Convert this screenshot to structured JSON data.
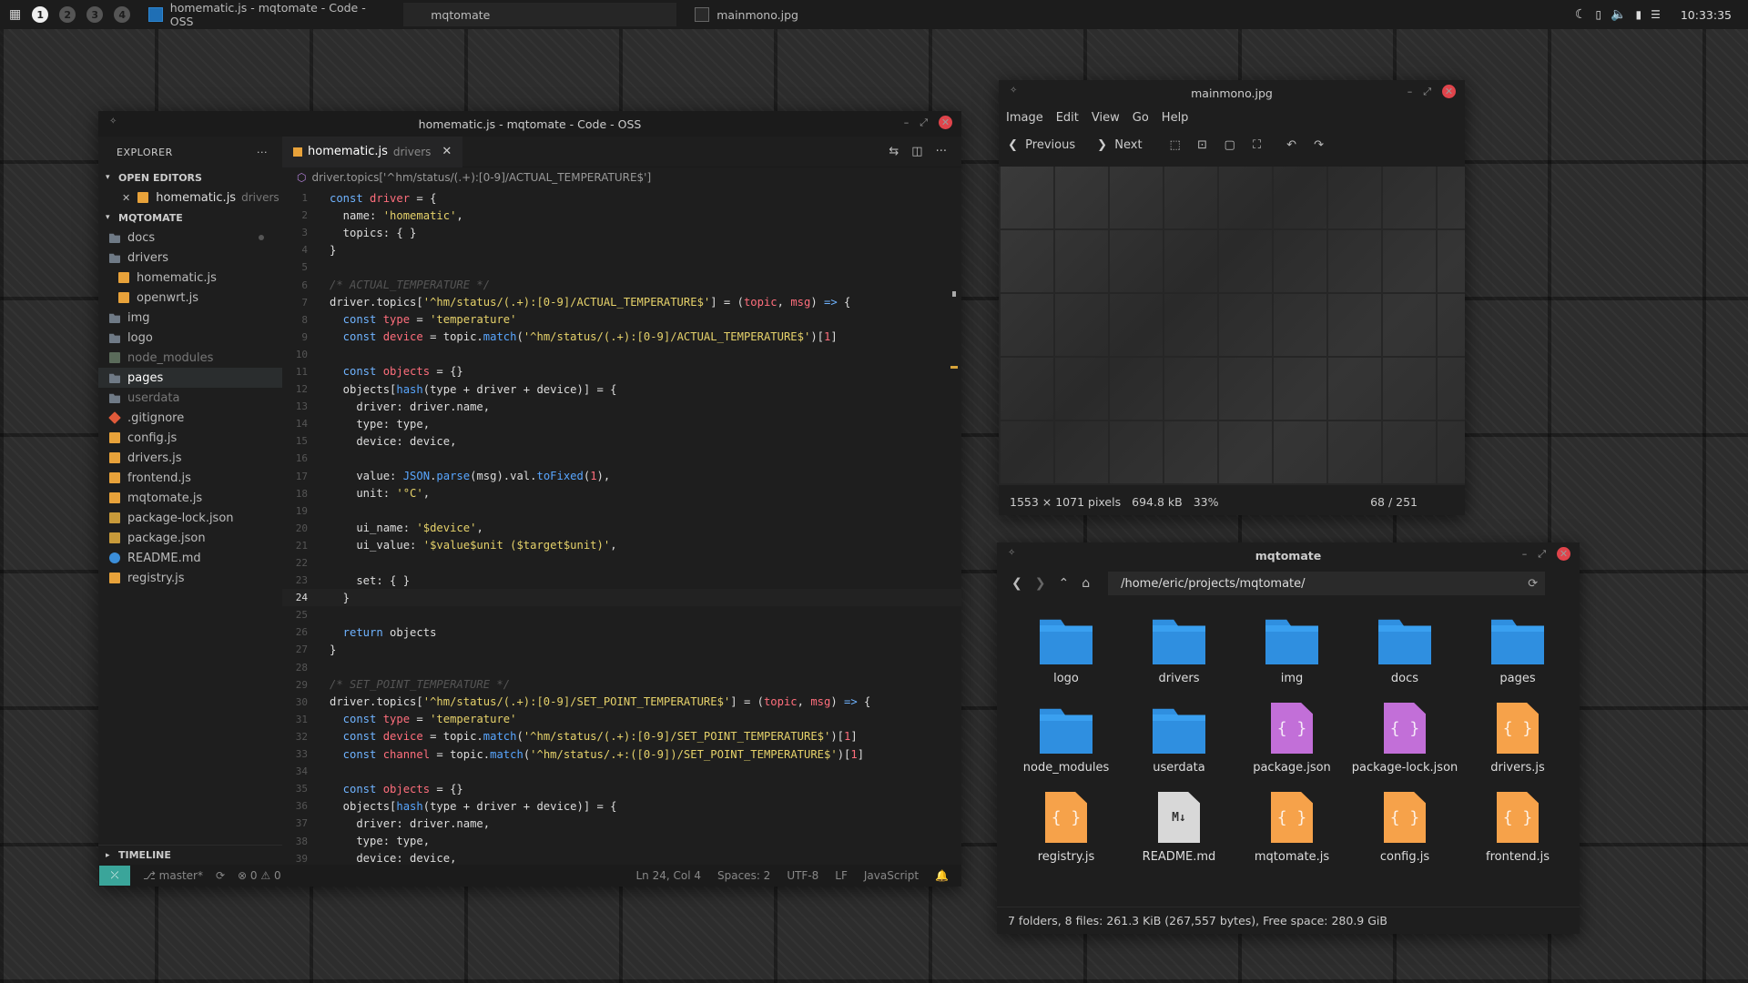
{
  "topbar": {
    "workspaces": [
      "1",
      "2",
      "3",
      "4"
    ],
    "tasks": [
      {
        "title": "homematic.js - mqtomate - Code - OSS"
      },
      {
        "title": "mqtomate"
      },
      {
        "title": "mainmono.jpg"
      }
    ],
    "clock": "10:33:35"
  },
  "vscode": {
    "title": "homematic.js - mqtomate - Code - OSS",
    "explorer": {
      "header": "EXPLORER",
      "dots": "···",
      "open_editors": "OPEN EDITORS",
      "open_file": {
        "name": "homematic.js",
        "dir": "drivers"
      },
      "project": "MQTOMATE",
      "tree": [
        {
          "name": "docs",
          "type": "folder",
          "indent": 0,
          "dot": true
        },
        {
          "name": "drivers",
          "type": "folder",
          "indent": 0
        },
        {
          "name": "homematic.js",
          "type": "js",
          "indent": 1
        },
        {
          "name": "openwrt.js",
          "type": "js",
          "indent": 1
        },
        {
          "name": "img",
          "type": "folder",
          "indent": 0
        },
        {
          "name": "logo",
          "type": "folder",
          "indent": 0
        },
        {
          "name": "node_modules",
          "type": "nm",
          "indent": 0,
          "muted": true
        },
        {
          "name": "pages",
          "type": "folder",
          "indent": 0,
          "selected": true
        },
        {
          "name": "userdata",
          "type": "folder",
          "indent": 0,
          "muted": true
        },
        {
          "name": ".gitignore",
          "type": "git",
          "indent": 0
        },
        {
          "name": "config.js",
          "type": "js",
          "indent": 0
        },
        {
          "name": "drivers.js",
          "type": "js",
          "indent": 0
        },
        {
          "name": "frontend.js",
          "type": "js",
          "indent": 0
        },
        {
          "name": "mqtomate.js",
          "type": "js",
          "indent": 0
        },
        {
          "name": "package-lock.json",
          "type": "json",
          "indent": 0
        },
        {
          "name": "package.json",
          "type": "json",
          "indent": 0
        },
        {
          "name": "README.md",
          "type": "info",
          "indent": 0
        },
        {
          "name": "registry.js",
          "type": "js",
          "indent": 0
        }
      ],
      "timeline": "TIMELINE"
    },
    "tab": {
      "name": "homematic.js",
      "dir": "drivers",
      "close": "✕"
    },
    "breadcrumb": "driver.topics['^hm/status/(.+):[0-9]/ACTUAL_TEMPERATURE$']",
    "current_line": 24,
    "code": [
      [
        [
          "k",
          "const "
        ],
        [
          "v",
          "driver"
        ],
        [
          "p",
          " = {"
        ]
      ],
      [
        [
          "p",
          "  name: "
        ],
        [
          "s",
          "'homematic'"
        ],
        [
          "p",
          ","
        ]
      ],
      [
        [
          "p",
          "  topics: { }"
        ]
      ],
      [
        [
          "p",
          "}"
        ]
      ],
      [],
      [
        [
          "c",
          "/* ACTUAL_TEMPERATURE */"
        ]
      ],
      [
        [
          "p",
          "driver.topics["
        ],
        [
          "s",
          "'^hm/status/(.+):[0-9]/ACTUAL_TEMPERATURE$'"
        ],
        [
          "p",
          "] = ("
        ],
        [
          "v",
          "topic"
        ],
        [
          "p",
          ", "
        ],
        [
          "v",
          "msg"
        ],
        [
          "p",
          ") "
        ],
        [
          "k",
          "=>"
        ],
        [
          "p",
          " {"
        ]
      ],
      [
        [
          "k",
          "  const "
        ],
        [
          "v",
          "type"
        ],
        [
          "p",
          " = "
        ],
        [
          "s",
          "'temperature'"
        ]
      ],
      [
        [
          "k",
          "  const "
        ],
        [
          "v",
          "device"
        ],
        [
          "p",
          " = topic."
        ],
        [
          "f",
          "match"
        ],
        [
          "p",
          "("
        ],
        [
          "s",
          "'^hm/status/(.+):[0-9]/ACTUAL_TEMPERATURE$'"
        ],
        [
          "p",
          ")["
        ],
        [
          "n",
          "1"
        ],
        [
          "p",
          "]"
        ]
      ],
      [],
      [
        [
          "k",
          "  const "
        ],
        [
          "v",
          "objects"
        ],
        [
          "p",
          " = {}"
        ]
      ],
      [
        [
          "p",
          "  objects["
        ],
        [
          "f",
          "hash"
        ],
        [
          "p",
          "(type + driver + device)] = {"
        ]
      ],
      [
        [
          "p",
          "    driver: driver.name,"
        ]
      ],
      [
        [
          "p",
          "    type: type,"
        ]
      ],
      [
        [
          "p",
          "    device: device,"
        ]
      ],
      [],
      [
        [
          "p",
          "    value: "
        ],
        [
          "f",
          "JSON"
        ],
        [
          "p",
          "."
        ],
        [
          "f",
          "parse"
        ],
        [
          "p",
          "(msg).val."
        ],
        [
          "f",
          "toFixed"
        ],
        [
          "p",
          "("
        ],
        [
          "n",
          "1"
        ],
        [
          "p",
          "),"
        ]
      ],
      [
        [
          "p",
          "    unit: "
        ],
        [
          "s",
          "'°C'"
        ],
        [
          "p",
          ","
        ]
      ],
      [],
      [
        [
          "p",
          "    ui_name: "
        ],
        [
          "s",
          "'$device'"
        ],
        [
          "p",
          ","
        ]
      ],
      [
        [
          "p",
          "    ui_value: "
        ],
        [
          "s",
          "'$value$unit ($target$unit)'"
        ],
        [
          "p",
          ","
        ]
      ],
      [],
      [
        [
          "p",
          "    set: { }"
        ]
      ],
      [
        [
          "p",
          "  }"
        ]
      ],
      [],
      [
        [
          "k",
          "  return "
        ],
        [
          "p",
          "objects"
        ]
      ],
      [
        [
          "p",
          "}"
        ]
      ],
      [],
      [
        [
          "c",
          "/* SET_POINT_TEMPERATURE */"
        ]
      ],
      [
        [
          "p",
          "driver.topics["
        ],
        [
          "s",
          "'^hm/status/(.+):[0-9]/SET_POINT_TEMPERATURE$'"
        ],
        [
          "p",
          "] = ("
        ],
        [
          "v",
          "topic"
        ],
        [
          "p",
          ", "
        ],
        [
          "v",
          "msg"
        ],
        [
          "p",
          ") "
        ],
        [
          "k",
          "=>"
        ],
        [
          "p",
          " {"
        ]
      ],
      [
        [
          "k",
          "  const "
        ],
        [
          "v",
          "type"
        ],
        [
          "p",
          " = "
        ],
        [
          "s",
          "'temperature'"
        ]
      ],
      [
        [
          "k",
          "  const "
        ],
        [
          "v",
          "device"
        ],
        [
          "p",
          " = topic."
        ],
        [
          "f",
          "match"
        ],
        [
          "p",
          "("
        ],
        [
          "s",
          "'^hm/status/(.+):[0-9]/SET_POINT_TEMPERATURE$'"
        ],
        [
          "p",
          ")["
        ],
        [
          "n",
          "1"
        ],
        [
          "p",
          "]"
        ]
      ],
      [
        [
          "k",
          "  const "
        ],
        [
          "v",
          "channel"
        ],
        [
          "p",
          " = topic."
        ],
        [
          "f",
          "match"
        ],
        [
          "p",
          "("
        ],
        [
          "s",
          "'^hm/status/.+:([0-9])/SET_POINT_TEMPERATURE$'"
        ],
        [
          "p",
          ")["
        ],
        [
          "n",
          "1"
        ],
        [
          "p",
          "]"
        ]
      ],
      [],
      [
        [
          "k",
          "  const "
        ],
        [
          "v",
          "objects"
        ],
        [
          "p",
          " = {}"
        ]
      ],
      [
        [
          "p",
          "  objects["
        ],
        [
          "f",
          "hash"
        ],
        [
          "p",
          "(type + driver + device)] = {"
        ]
      ],
      [
        [
          "p",
          "    driver: driver.name,"
        ]
      ],
      [
        [
          "p",
          "    type: type,"
        ]
      ],
      [
        [
          "p",
          "    device: device,"
        ]
      ]
    ],
    "status": {
      "branch": "master*",
      "sync": "⟳",
      "problems": "⊗ 0 ⚠ 0",
      "position": "Ln 24, Col 4",
      "spaces": "Spaces: 2",
      "encoding": "UTF-8",
      "eol": "LF",
      "language": "JavaScript",
      "bell": "🔔"
    }
  },
  "viewer": {
    "title": "mainmono.jpg",
    "menu": [
      "Image",
      "Edit",
      "View",
      "Go",
      "Help"
    ],
    "prev": "Previous",
    "next": "Next",
    "status": {
      "dimensions": "1553 × 1071 pixels",
      "size": "694.8 kB",
      "zoom": "33%",
      "count": "68 / 251"
    }
  },
  "files": {
    "title": "mqtomate",
    "path": "/home/eric/projects/mqtomate/",
    "items": [
      {
        "name": "logo",
        "type": "folder"
      },
      {
        "name": "drivers",
        "type": "folder"
      },
      {
        "name": "img",
        "type": "folder"
      },
      {
        "name": "docs",
        "type": "folder"
      },
      {
        "name": "pages",
        "type": "folder"
      },
      {
        "name": "node_modules",
        "type": "folder"
      },
      {
        "name": "userdata",
        "type": "folder"
      },
      {
        "name": "package.json",
        "type": "json"
      },
      {
        "name": "package-lock.json",
        "type": "json"
      },
      {
        "name": "drivers.js",
        "type": "js"
      },
      {
        "name": "registry.js",
        "type": "js"
      },
      {
        "name": "README.md",
        "type": "md"
      },
      {
        "name": "mqtomate.js",
        "type": "js"
      },
      {
        "name": "config.js",
        "type": "js"
      },
      {
        "name": "frontend.js",
        "type": "js"
      }
    ],
    "status": "7 folders, 8 files: 261.3 KiB (267,557 bytes), Free space: 280.9 GiB"
  },
  "colors": {
    "accent": "#3aa59a",
    "close": "#e0444b",
    "folder": "#2f8fe0",
    "json_icon": "#c26fd8",
    "js_icon": "#f6a24a"
  }
}
